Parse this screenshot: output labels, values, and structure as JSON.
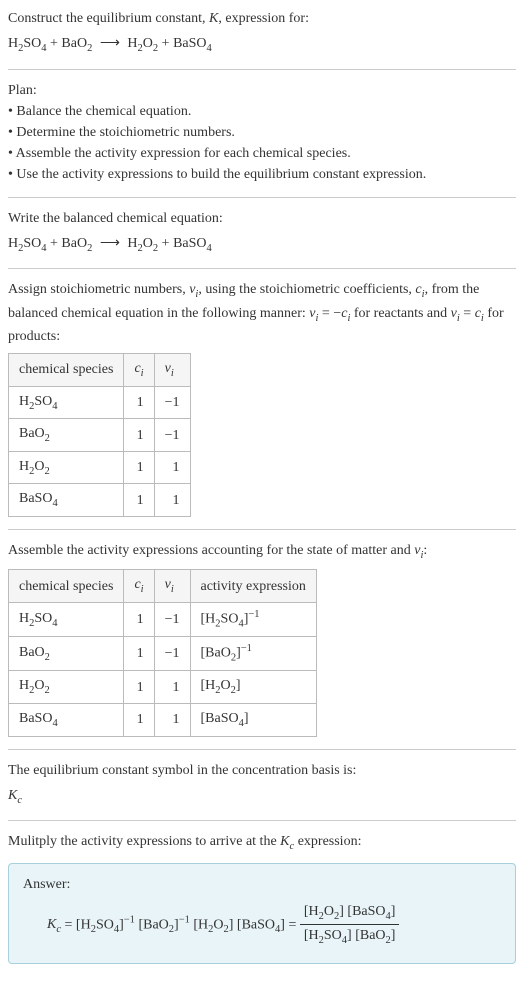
{
  "header": {
    "line1": "Construct the equilibrium constant, ",
    "K": "K",
    "line1b": ", expression for:",
    "equation_lhs1": "H",
    "equation_lhs1_sub": "2",
    "equation_lhs2": "SO",
    "equation_lhs2_sub": "4",
    "plus1": " + BaO",
    "plus1_sub": "2",
    "arrow": "⟶",
    "equation_rhs1": "H",
    "equation_rhs1_sub": "2",
    "equation_rhs2": "O",
    "equation_rhs2_sub": "2",
    "plus2": " + BaSO",
    "plus2_sub": "4"
  },
  "plan": {
    "title": "Plan:",
    "items": [
      "Balance the chemical equation.",
      "Determine the stoichiometric numbers.",
      "Assemble the activity expression for each chemical species.",
      "Use the activity expressions to build the equilibrium constant expression."
    ]
  },
  "balanced": {
    "intro": "Write the balanced chemical equation:"
  },
  "stoich": {
    "intro1": "Assign stoichiometric numbers, ",
    "nu": "ν",
    "i": "i",
    "intro2": ", using the stoichiometric coefficients, ",
    "c": "c",
    "intro3": ", from the balanced chemical equation in the following manner: ",
    "rule1a": "ν",
    "rule1b": " = −",
    "rule1c": "c",
    "rule1d": " for reactants and ",
    "rule2a": "ν",
    "rule2b": " = ",
    "rule2c": "c",
    "rule2d": " for products:",
    "table": {
      "headers": [
        "chemical species",
        "c_i",
        "ν_i"
      ],
      "rows": [
        {
          "species": "H2SO4",
          "c": "1",
          "nu": "−1"
        },
        {
          "species": "BaO2",
          "c": "1",
          "nu": "−1"
        },
        {
          "species": "H2O2",
          "c": "1",
          "nu": "1"
        },
        {
          "species": "BaSO4",
          "c": "1",
          "nu": "1"
        }
      ]
    }
  },
  "activity": {
    "intro1": "Assemble the activity expressions accounting for the state of matter and ",
    "intro2": ":",
    "table": {
      "headers": [
        "chemical species",
        "c_i",
        "ν_i",
        "activity expression"
      ],
      "rows": [
        {
          "species": "H2SO4",
          "c": "1",
          "nu": "−1",
          "act": "[H2SO4]^-1"
        },
        {
          "species": "BaO2",
          "c": "1",
          "nu": "−1",
          "act": "[BaO2]^-1"
        },
        {
          "species": "H2O2",
          "c": "1",
          "nu": "1",
          "act": "[H2O2]"
        },
        {
          "species": "BaSO4",
          "c": "1",
          "nu": "1",
          "act": "[BaSO4]"
        }
      ]
    }
  },
  "kc_symbol": {
    "intro": "The equilibrium constant symbol in the concentration basis is:",
    "symbol": "K",
    "sub": "c"
  },
  "multiply": {
    "intro1": "Mulitply the activity expressions to arrive at the ",
    "intro2": " expression:"
  },
  "answer": {
    "label": "Answer:"
  }
}
